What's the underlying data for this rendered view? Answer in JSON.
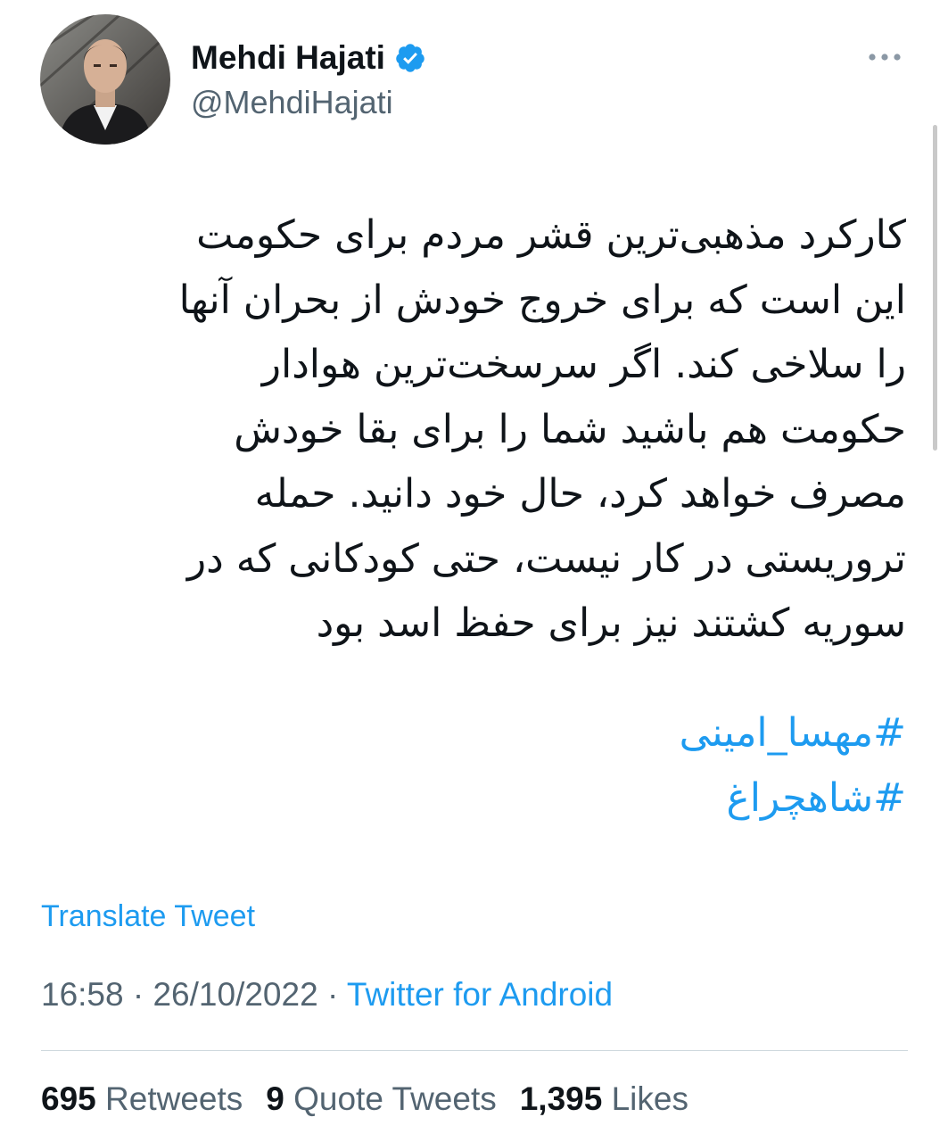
{
  "author": {
    "display_name": "Mehdi Hajati",
    "handle": "@MehdiHajati",
    "verified": true,
    "avatar_icon": "profile-photo"
  },
  "tweet": {
    "lines": [
      "کارکرد مذهبی‌ترین قشر مردم برای حکومت",
      "این است که برای خروج خودش از بحران آنها",
      "را سلاخی کند. اگر سرسخت‌ترین هوادار",
      "حکومت هم باشید شما را برای بقا خودش",
      "مصرف خواهد کرد، حال خود دانید. حمله",
      "تروریستی در کار نیست، حتی کودکانی که در",
      "سوریه کشتند نیز برای حفظ اسد بود"
    ],
    "hashtags": [
      "#مهسا_امینی",
      "#شاهچراغ"
    ],
    "translate_label": "Translate Tweet",
    "time": "16:58",
    "date": "26/10/2022",
    "separator": "·",
    "source": "Twitter for Android"
  },
  "stats": {
    "retweets_count": "695",
    "retweets_label": "Retweets",
    "quotes_count": "9",
    "quotes_label": "Quote Tweets",
    "likes_count": "1,395",
    "likes_label": "Likes"
  },
  "colors": {
    "accent": "#1d9bf0",
    "secondary_text": "#536471",
    "primary_text": "#0f1419"
  }
}
